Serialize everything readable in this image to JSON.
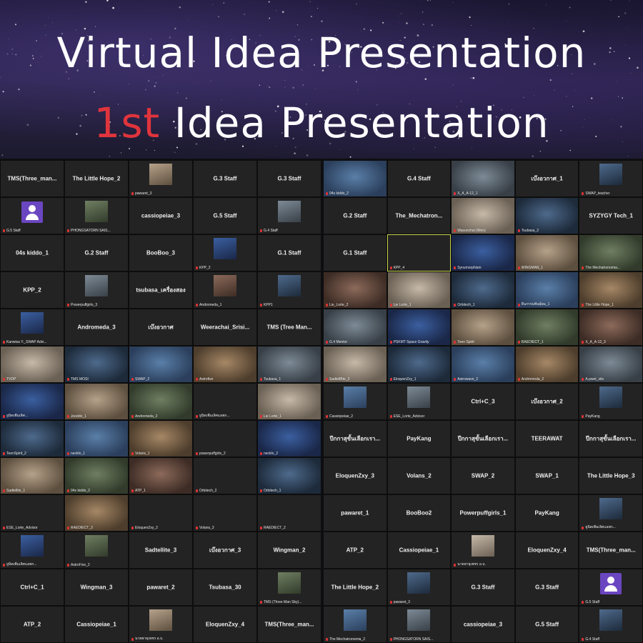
{
  "banner": {
    "title_line1": "Virtual Idea Presentation",
    "title_line2_highlight": "1st",
    "title_line2_rest": " Idea Presentation"
  },
  "colors": {
    "highlight": "#e0343c",
    "active_border": "#c8d64a",
    "mic_muted": "#d33333"
  },
  "left_grid": [
    [
      {
        "t": "name",
        "v": "TMS(Three_man..."
      },
      {
        "t": "name",
        "v": "The Little Hope_2"
      },
      {
        "t": "thumb",
        "v": "pawaret_3"
      },
      {
        "t": "name",
        "v": "G.3 Staff"
      },
      {
        "t": "name",
        "v": "G.3 Staff"
      }
    ],
    [
      {
        "t": "avatar",
        "v": "G.5 Staff"
      },
      {
        "t": "thumb",
        "v": "PHONGSATORN SAIS..."
      },
      {
        "t": "name",
        "v": "cassiopeiae_3"
      },
      {
        "t": "name",
        "v": "G.5 Staff"
      },
      {
        "t": "thumb",
        "v": "G.4 Staff"
      }
    ],
    [
      {
        "t": "name",
        "v": "04s kiddo_1"
      },
      {
        "t": "name",
        "v": "G.2 Staff"
      },
      {
        "t": "name",
        "v": "BooBoo_3"
      },
      {
        "t": "thumb",
        "v": "KPP_2"
      },
      {
        "t": "name",
        "v": "G.1 Staff"
      }
    ],
    [
      {
        "t": "name",
        "v": "KPP_2"
      },
      {
        "t": "thumb",
        "v": "Powerpuffgirls_3"
      },
      {
        "t": "name",
        "v": "tsubasa_เครื่องสอง"
      },
      {
        "t": "thumb",
        "v": "Andromeda_1"
      },
      {
        "t": "thumb",
        "v": "KPP1"
      }
    ],
    [
      {
        "t": "thumb",
        "v": "Kanwisa Y._SWAP Advi..."
      },
      {
        "t": "name",
        "v": "Andromeda_3"
      },
      {
        "t": "name",
        "v": "เบ๊งอวกาศ"
      },
      {
        "t": "name",
        "v": "Weerachai_Srisi..."
      },
      {
        "t": "name",
        "v": "TMS (Tree Man..."
      }
    ],
    [
      {
        "t": "video",
        "v": "TVDP"
      },
      {
        "t": "video",
        "v": "TMS MOSI"
      },
      {
        "t": "video",
        "v": "SWAP_2"
      },
      {
        "t": "video",
        "v": "Astrofive"
      },
      {
        "t": "video",
        "v": "Tsubasa_1"
      }
    ],
    [
      {
        "t": "video",
        "v": "ยูนิตเพิ่มเลิศ..."
      },
      {
        "t": "video",
        "v": "Jooddo_1"
      },
      {
        "t": "video",
        "v": "Andromeda_2"
      },
      {
        "t": "cap",
        "v": "ยูนิตเพิ่มเลิศแอพก..."
      },
      {
        "t": "video",
        "v": "Lie Lorte_1"
      }
    ],
    [
      {
        "t": "video",
        "v": "TeenSpirit_2"
      },
      {
        "t": "video",
        "v": "necklo_1"
      },
      {
        "t": "video",
        "v": "Volans_1"
      },
      {
        "t": "cap",
        "v": "powerpuffgirls_2"
      },
      {
        "t": "video",
        "v": "necklo_2"
      }
    ],
    [
      {
        "t": "video",
        "v": "Sadtellite_1"
      },
      {
        "t": "video",
        "v": "04s kiddo_2"
      },
      {
        "t": "video",
        "v": "ATP_1"
      },
      {
        "t": "cap",
        "v": "Orbitech_2"
      },
      {
        "t": "video",
        "v": "Orbitech_1"
      }
    ],
    [
      {
        "t": "cap",
        "v": "ESE_Lorte_Advisor"
      },
      {
        "t": "video",
        "v": "RAEDIECT_3"
      },
      {
        "t": "cap",
        "v": "EloquenZxy_2"
      },
      {
        "t": "cap",
        "v": "Volans_3"
      },
      {
        "t": "cap",
        "v": "RAEDIECT_2"
      }
    ],
    [
      {
        "t": "thumb",
        "v": "ยูนิตเพิ่มเลิศแอพก..."
      },
      {
        "t": "thumb",
        "v": "AstroFive_2"
      },
      {
        "t": "name",
        "v": "Sadtellite_3"
      },
      {
        "t": "name",
        "v": "เบ๊งอวกาศ_3"
      },
      {
        "t": "name",
        "v": "Wingman_2"
      }
    ],
    [
      {
        "t": "name",
        "v": "Ctrl+C_1"
      },
      {
        "t": "name",
        "v": "Wingman_3"
      },
      {
        "t": "name",
        "v": "pawaret_2"
      },
      {
        "t": "name",
        "v": "Tsubasa_30"
      },
      {
        "t": "thumb",
        "v": "TMS (Three Man Sky)..."
      }
    ],
    [
      {
        "t": "name",
        "v": "ATP_2"
      },
      {
        "t": "name",
        "v": "Cassiopeiae_1"
      },
      {
        "t": "thumb",
        "v": "นายพายุเพชร อ.บ."
      },
      {
        "t": "name",
        "v": "EloquenZxy_4"
      },
      {
        "t": "name",
        "v": "TMS(Three_man..."
      }
    ]
  ],
  "right_grid": [
    [
      {
        "t": "video",
        "v": "04s kiddo_2"
      },
      {
        "t": "name",
        "v": "G.4 Staff"
      },
      {
        "t": "video",
        "v": "X_A_A-12_1"
      },
      {
        "t": "name",
        "v": "เบ๊งอวกาศ_1"
      },
      {
        "t": "thumb",
        "v": "SWAP_teacher"
      }
    ],
    [
      {
        "t": "name",
        "v": "G.2 Staff"
      },
      {
        "t": "name",
        "v": "The_Mechatron..."
      },
      {
        "t": "video",
        "v": "Wasunchai (Wen)"
      },
      {
        "t": "video",
        "v": "Tsubasa_2"
      },
      {
        "t": "name",
        "v": "SYZYGY Tech_1"
      }
    ],
    [
      {
        "t": "name",
        "v": "G.1 Staff"
      },
      {
        "t": "active",
        "v": "KPP_4"
      },
      {
        "t": "video",
        "v": "Synumorphism"
      },
      {
        "t": "video",
        "v": "WINGMAN_1"
      },
      {
        "t": "video",
        "v": "The Mechatronomia..."
      }
    ],
    [
      {
        "t": "video",
        "v": "Lie_Lorte_2"
      },
      {
        "t": "video",
        "v": "Lie Lorte_1"
      },
      {
        "t": "video",
        "v": "Orbitech_1"
      },
      {
        "t": "video",
        "v": "ยีนกรรมพันธุ์ผม_1"
      },
      {
        "t": "video",
        "v": "The Little Hope_1"
      }
    ],
    [
      {
        "t": "video",
        "v": "G.4 Mentor"
      },
      {
        "t": "video",
        "v": "PSKMT Space Gravity"
      },
      {
        "t": "video",
        "v": "Teen Spirit"
      },
      {
        "t": "video",
        "v": "RAEDIECT_1"
      },
      {
        "t": "video",
        "v": "X_A_A-12_3"
      }
    ],
    [
      {
        "t": "video",
        "v": "SadtellBte_2"
      },
      {
        "t": "video",
        "v": "EloquenZxy_1"
      },
      {
        "t": "video",
        "v": "Astrowave_2"
      },
      {
        "t": "video",
        "v": "Andromeda_2"
      },
      {
        "t": "video",
        "v": "A.pwet_sits"
      }
    ],
    [
      {
        "t": "thumb",
        "v": "Cassiopeiae_2"
      },
      {
        "t": "thumb",
        "v": "ESE_Lorte_Advisor"
      },
      {
        "t": "name",
        "v": "Ctrl+C_3"
      },
      {
        "t": "name",
        "v": "เบ๊งอวกาศ_2"
      },
      {
        "t": "thumb",
        "v": "PayKang"
      }
    ],
    [
      {
        "t": "name",
        "v": "ปีกกาสุขั้นเลือกเรา..."
      },
      {
        "t": "name",
        "v": "PayKang"
      },
      {
        "t": "name",
        "v": "ปีกกาสุขั้นเลือกเรา..."
      },
      {
        "t": "name",
        "v": "TEERAWAT"
      },
      {
        "t": "name",
        "v": "ปีกกาสุขั้นเลือกเรา..."
      }
    ],
    [
      {
        "t": "name",
        "v": "EloquenZxy_3"
      },
      {
        "t": "name",
        "v": "Volans_2"
      },
      {
        "t": "name",
        "v": "SWAP_2"
      },
      {
        "t": "name",
        "v": "SWAP_1"
      },
      {
        "t": "name",
        "v": "The Little Hope_3"
      }
    ],
    [
      {
        "t": "name",
        "v": "pawaret_1"
      },
      {
        "t": "name",
        "v": "BooBoo2"
      },
      {
        "t": "name",
        "v": "Powerpuffgirls_1"
      },
      {
        "t": "name",
        "v": "PayKang"
      },
      {
        "t": "thumb",
        "v": "ยูนิตเพิ่มเลิศแอพก..."
      }
    ],
    [
      {
        "t": "name",
        "v": "ATP_2"
      },
      {
        "t": "name",
        "v": "Cassiopeiae_1"
      },
      {
        "t": "thumb",
        "v": "นายพายุเพชร อ.บ."
      },
      {
        "t": "name",
        "v": "EloquenZxy_4"
      },
      {
        "t": "name",
        "v": "TMS(Three_man..."
      }
    ],
    [
      {
        "t": "name",
        "v": "The Little Hope_2"
      },
      {
        "t": "thumb",
        "v": "pawaret_3"
      },
      {
        "t": "name",
        "v": "G.3 Staff"
      },
      {
        "t": "name",
        "v": "G.3 Staff"
      },
      {
        "t": "avatar",
        "v": "G.5 Staff"
      }
    ],
    [
      {
        "t": "thumb",
        "v": "The Mechatronomia_2"
      },
      {
        "t": "thumb",
        "v": "PHONGSATORN SAIS..."
      },
      {
        "t": "name",
        "v": "cassiopeiae_3"
      },
      {
        "t": "name",
        "v": "G.5 Staff"
      },
      {
        "t": "thumb",
        "v": "G.4 Staff"
      }
    ]
  ]
}
